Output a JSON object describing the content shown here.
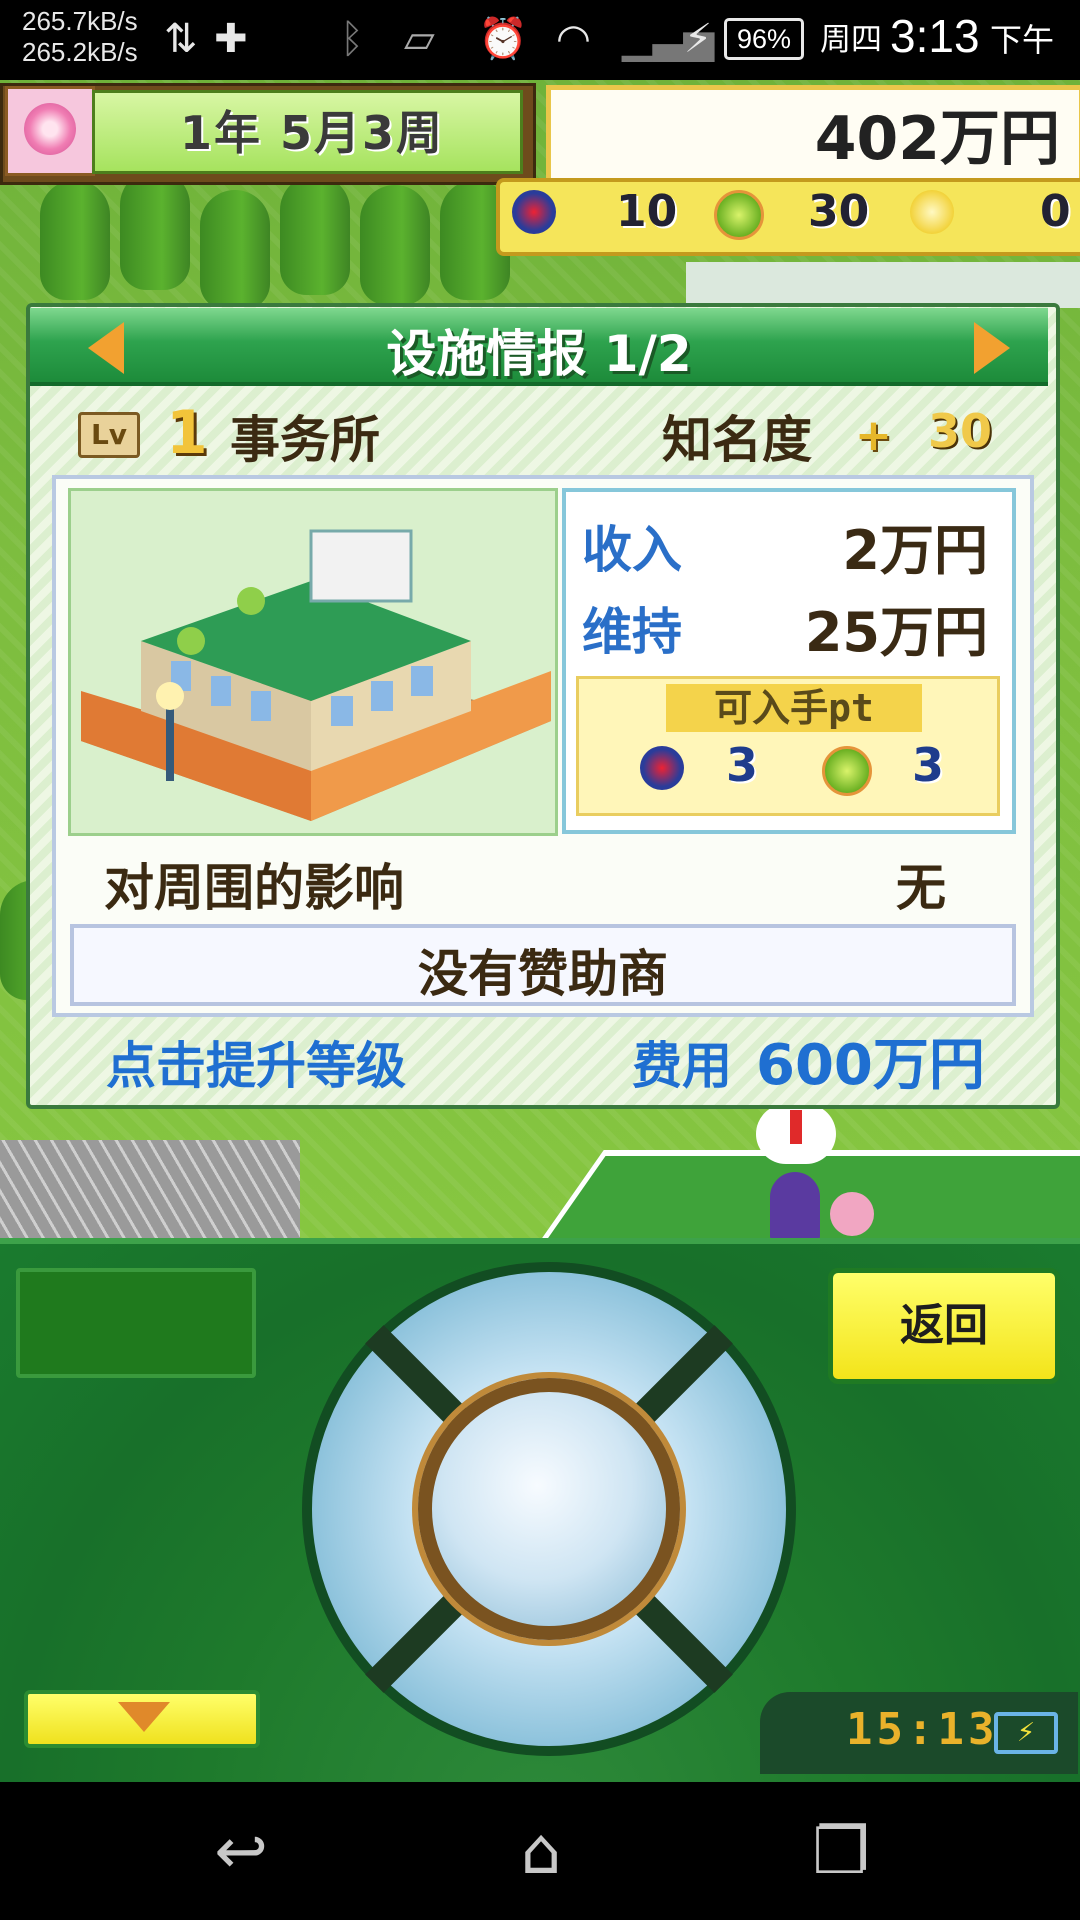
{
  "status_bar": {
    "net_up": "265.7kB/s",
    "net_down": "265.2kB/s",
    "battery": "96%",
    "weekday": "周四",
    "time": "3:13",
    "ampm": "下午"
  },
  "hud": {
    "date": "1年 5月3周",
    "money": "402万円",
    "points": [
      {
        "icon": "shield-icon",
        "value": "10"
      },
      {
        "icon": "tennis-ball-icon",
        "value": "30"
      },
      {
        "icon": "lightbulb-icon",
        "value": "0"
      }
    ]
  },
  "panel": {
    "title": "设施情报 1/2",
    "level_badge": "Lv",
    "level": "1",
    "facility_name": "事务所",
    "fame_label": "知名度",
    "fame_plus": "+",
    "fame_value": "30",
    "income_label": "收入",
    "income_value": "2万円",
    "upkeep_label": "维持",
    "upkeep_value": "25万円",
    "pt_label": "可入手pt",
    "pt_gain": [
      {
        "icon": "shield-icon",
        "value": "3"
      },
      {
        "icon": "tennis-ball-icon",
        "value": "3"
      }
    ],
    "influence_label": "对周围的影响",
    "influence_value": "无",
    "sponsor": "没有赞助商",
    "upgrade_link": "点击提升等级",
    "cost_label": "费用",
    "cost_value": "600万円"
  },
  "controller": {
    "back_label": "返回",
    "clock": "15:13"
  },
  "colors": {
    "accent_green": "#1d8b3a",
    "link_blue": "#1f6fd1",
    "button_yellow": "#f3e41a"
  }
}
